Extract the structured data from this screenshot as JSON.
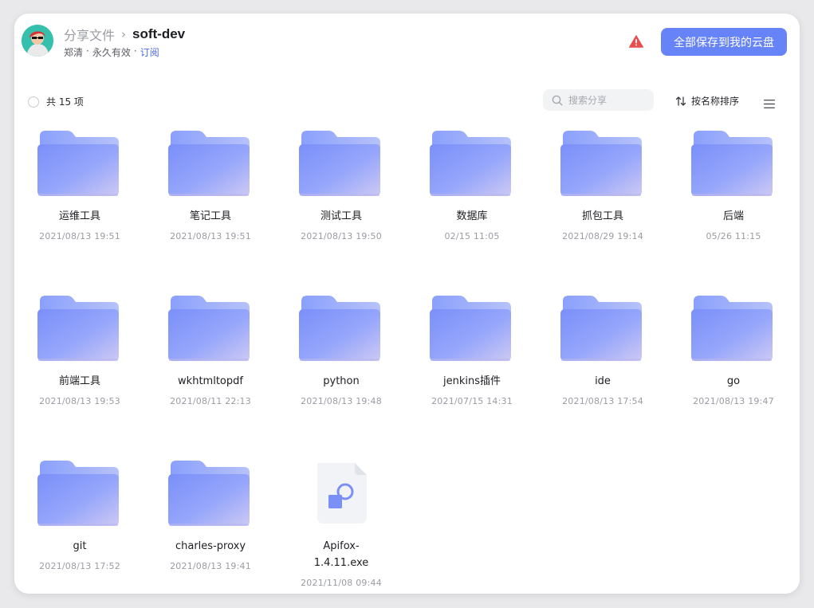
{
  "header": {
    "breadcrumb_parent": "分享文件",
    "breadcrumb_separator": "›",
    "breadcrumb_current": "soft-dev",
    "owner": "郑清",
    "separator": "·",
    "validity": "永久有效",
    "subscribe_link": "订阅",
    "save_button": "全部保存到我的云盘"
  },
  "toolbar": {
    "count_label": "共 15 项",
    "search_placeholder": "搜索分享",
    "sort_label": "按名称排序"
  },
  "colors": {
    "accent": "#6684f7",
    "warning": "#e84f4f",
    "link": "#4d6af0"
  },
  "files": [
    {
      "name": "运维工具",
      "date": "2021/08/13 19:51",
      "type": "folder"
    },
    {
      "name": "笔记工具",
      "date": "2021/08/13 19:51",
      "type": "folder"
    },
    {
      "name": "测试工具",
      "date": "2021/08/13 19:50",
      "type": "folder"
    },
    {
      "name": "数据库",
      "date": "02/15 11:05",
      "type": "folder"
    },
    {
      "name": "抓包工具",
      "date": "2021/08/29 19:14",
      "type": "folder"
    },
    {
      "name": "后端",
      "date": "05/26 11:15",
      "type": "folder"
    },
    {
      "name": "前端工具",
      "date": "2021/08/13 19:53",
      "type": "folder"
    },
    {
      "name": "wkhtmltopdf",
      "date": "2021/08/11 22:13",
      "type": "folder"
    },
    {
      "name": "python",
      "date": "2021/08/13 19:48",
      "type": "folder"
    },
    {
      "name": "jenkins插件",
      "date": "2021/07/15 14:31",
      "type": "folder"
    },
    {
      "name": "ide",
      "date": "2021/08/13 17:54",
      "type": "folder"
    },
    {
      "name": "go",
      "date": "2021/08/13 19:47",
      "type": "folder"
    },
    {
      "name": "git",
      "date": "2021/08/13 17:52",
      "type": "folder"
    },
    {
      "name": "charles-proxy",
      "date": "2021/08/13 19:41",
      "type": "folder"
    },
    {
      "name": "Apifox-1.4.11.exe",
      "name_lines": [
        "Apifox-",
        "1.4.11.exe"
      ],
      "date": "2021/11/08 09:44",
      "type": "exe-file"
    }
  ],
  "icons": {
    "folder": "folder-icon",
    "file": "exe-file-icon",
    "search": "search-icon",
    "sort": "sort-icon",
    "list_view": "list-view-icon",
    "warning": "warning-icon"
  }
}
